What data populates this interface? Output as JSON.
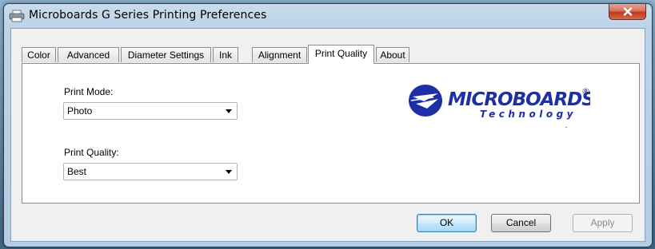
{
  "window": {
    "title": "Microboards G Series Printing Preferences",
    "close_glyph": "✕"
  },
  "tabs": [
    {
      "label": "Color",
      "active": false
    },
    {
      "label": "Advanced",
      "active": false
    },
    {
      "label": "Diameter Settings",
      "active": false
    },
    {
      "label": "Ink",
      "active": false
    },
    {
      "label": "Alignment",
      "active": false
    },
    {
      "label": "Print Quality",
      "active": true
    },
    {
      "label": "About",
      "active": false
    }
  ],
  "print_mode": {
    "label": "Print Mode:",
    "value": "Photo"
  },
  "print_quality": {
    "label": "Print Quality:",
    "value": "Best"
  },
  "logo": {
    "brand": "MICROBOARDS",
    "registered": "®",
    "tagline": "Technology",
    "color": "#1c2fa5"
  },
  "buttons": {
    "ok": "OK",
    "cancel": "Cancel",
    "apply": "Apply"
  }
}
